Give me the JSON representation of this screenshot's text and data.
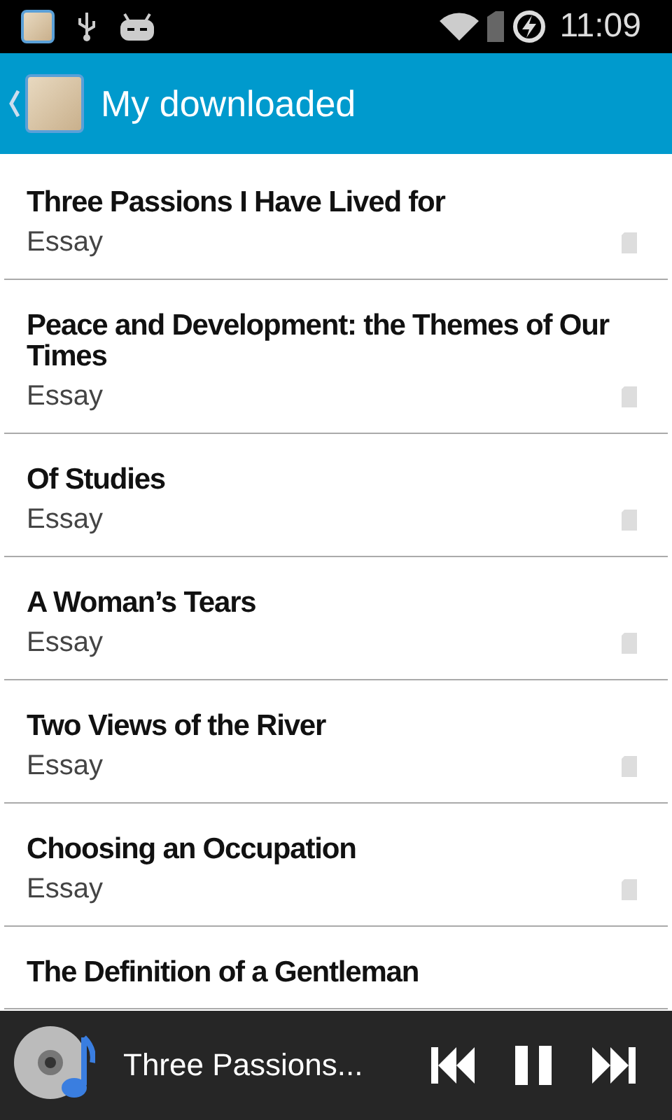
{
  "status_bar": {
    "time": "11:09"
  },
  "action_bar": {
    "title": "My downloaded"
  },
  "items": [
    {
      "title": "Three Passions I Have Lived for",
      "category": "Essay"
    },
    {
      "title": "Peace and Development: the Themes of Our Times",
      "category": "Essay"
    },
    {
      "title": "Of Studies",
      "category": "Essay"
    },
    {
      "title": "A Woman’s Tears",
      "category": "Essay"
    },
    {
      "title": "Two Views of the River",
      "category": "Essay"
    },
    {
      "title": "Choosing an Occupation",
      "category": "Essay"
    },
    {
      "title": "The Definition of a Gentleman"
    }
  ],
  "player": {
    "track": "Three Passions..."
  }
}
